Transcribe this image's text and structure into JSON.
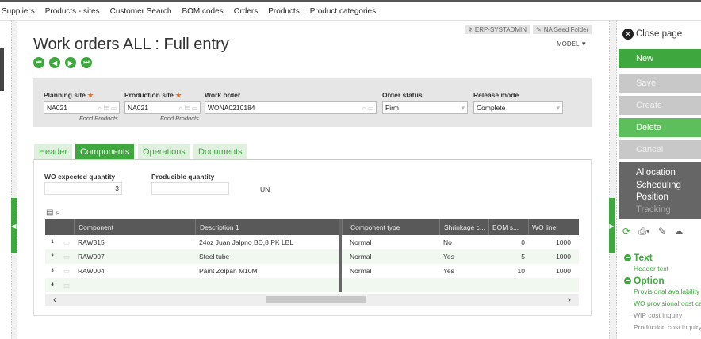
{
  "nav": [
    "Suppliers",
    "Products - sites",
    "Customer Search",
    "BOM codes",
    "Orders",
    "Products",
    "Product categories"
  ],
  "title": "Work orders ALL : Full entry",
  "chips": {
    "user": "ERP-SYSTADMIN",
    "folder": "NA Seed Folder"
  },
  "model": "MODEL",
  "criteria": {
    "planning_site": {
      "label": "Planning site",
      "value": "NA021",
      "sub": "Food Products"
    },
    "production_site": {
      "label": "Production site",
      "value": "NA021",
      "sub": "Food Products"
    },
    "work_order": {
      "label": "Work order",
      "value": "WONA0210184"
    },
    "order_status": {
      "label": "Order status",
      "value": "Firm"
    },
    "release_mode": {
      "label": "Release mode",
      "value": "Complete"
    }
  },
  "tabs": [
    "Header",
    "Components",
    "Operations",
    "Documents"
  ],
  "qty": {
    "expected_label": "WO expected quantity",
    "expected": "3",
    "producible_label": "Producible quantity",
    "producible": "",
    "unit": "UN"
  },
  "grid": {
    "columns": [
      "Component",
      "Description 1",
      "Component type",
      "Shrinkage c...",
      "BOM s...",
      "WO line"
    ],
    "rows": [
      {
        "n": "1",
        "component": "RAW315",
        "desc": "24oz Juan Jalpno BD,8 PK LBL",
        "type": "Normal",
        "shrink": "No",
        "bom": "0",
        "line": "1000"
      },
      {
        "n": "2",
        "component": "RAW007",
        "desc": "Steel tube",
        "type": "Normal",
        "shrink": "Yes",
        "bom": "5",
        "line": "1000"
      },
      {
        "n": "3",
        "component": "RAW004",
        "desc": "Paint Zolpan M10M",
        "type": "Normal",
        "shrink": "Yes",
        "bom": "10",
        "line": "1000"
      },
      {
        "n": "4",
        "component": "",
        "desc": "",
        "type": "",
        "shrink": "",
        "bom": "",
        "line": ""
      }
    ]
  },
  "right": {
    "close": "Close page",
    "buttons": {
      "new": "New",
      "save": "Save",
      "create": "Create",
      "delete": "Delete",
      "cancel": "Cancel"
    },
    "menu": [
      "Allocation",
      "Scheduling",
      "Position",
      "Tracking"
    ],
    "text_section": "Text",
    "text_links": [
      "Header text"
    ],
    "option_section": "Option",
    "option_links": [
      "Provisional availability",
      "WO provisional cost ca",
      "WIP cost inquiry",
      "Production cost inquiry"
    ]
  },
  "colors": {
    "accent": "#3ea83e",
    "dark": "#595959"
  }
}
